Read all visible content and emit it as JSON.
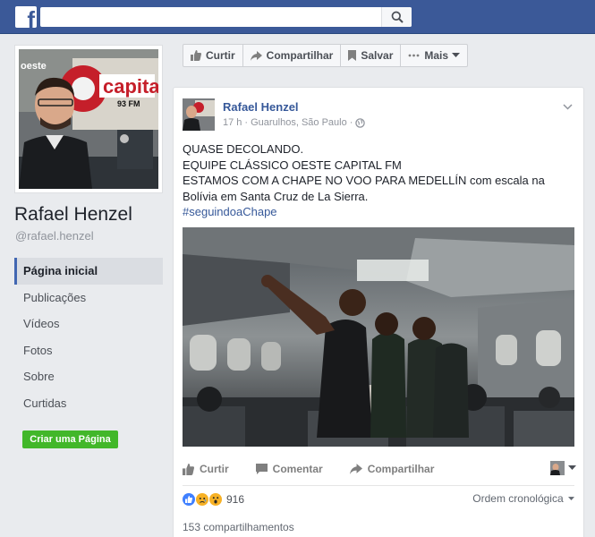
{
  "topbar": {
    "logo": "f",
    "search_placeholder": "",
    "search_icon": "search-icon"
  },
  "profile": {
    "name": "Rafael Henzel",
    "username": "@rafael.henzel"
  },
  "leftnav": {
    "items": [
      {
        "label": "Página inicial",
        "active": true
      },
      {
        "label": "Publicações"
      },
      {
        "label": "Vídeos"
      },
      {
        "label": "Fotos"
      },
      {
        "label": "Sobre"
      },
      {
        "label": "Curtidas"
      }
    ],
    "create_page": "Criar uma Página"
  },
  "actionbar": {
    "like": "Curtir",
    "share": "Compartilhar",
    "save": "Salvar",
    "more": "Mais"
  },
  "post": {
    "author": "Rafael Henzel",
    "time": "17 h",
    "location": "Guarulhos, São Paulo",
    "lines": [
      "QUASE DECOLANDO.",
      "EQUIPE CLÁSSICO OESTE CAPITAL FM",
      "ESTAMOS COM A CHAPE NO VOO PARA MEDELLÍN com escala na Bolívia em Santa Cruz de La Sierra."
    ],
    "hashtag": "#seguindoaChape",
    "actions": {
      "like": "Curtir",
      "comment": "Comentar",
      "share": "Compartilhar"
    },
    "reactions_count": "916",
    "order": "Ordem cronológica",
    "shares": "153 compartilhamentos"
  },
  "colors": {
    "brand": "#3b5998",
    "link": "#365899",
    "green": "#42b72a",
    "like_blue": "#4080ff",
    "sad_yellow": "#f7b125"
  }
}
